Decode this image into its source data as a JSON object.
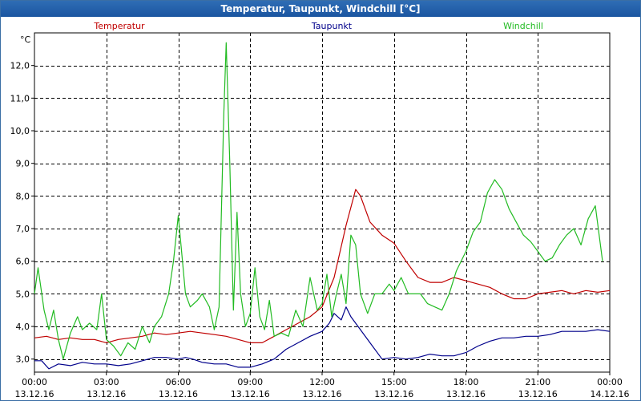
{
  "window": {
    "title": "Temperatur, Taupunkt, Windchill [°C]"
  },
  "chart_data": {
    "type": "line",
    "title": "Temperatur, Taupunkt, Windchill [°C]",
    "ylabel": "°C",
    "xlabel": "",
    "ylim": [
      2.6,
      13.0
    ],
    "xlim": [
      0,
      24
    ],
    "grid": true,
    "legend": "top",
    "yticks": [
      3.0,
      4.0,
      5.0,
      6.0,
      7.0,
      8.0,
      9.0,
      10.0,
      11.0,
      12.0
    ],
    "ytick_labels": [
      "3,0",
      "4,0",
      "5,0",
      "6,0",
      "7,0",
      "8,0",
      "9,0",
      "10,0",
      "11,0",
      "12,0"
    ],
    "xticks": [
      0,
      3,
      6,
      9,
      12,
      15,
      18,
      21,
      24
    ],
    "xtick_labels": [
      [
        "00:00",
        "13.12.16"
      ],
      [
        "03:00",
        "13.12.16"
      ],
      [
        "06:00",
        "13.12.16"
      ],
      [
        "09:00",
        "13.12.16"
      ],
      [
        "12:00",
        "13.12.16"
      ],
      [
        "15:00",
        "13.12.16"
      ],
      [
        "18:00",
        "13.12.16"
      ],
      [
        "21:00",
        "13.12.16"
      ],
      [
        "00:00",
        "14.12.16"
      ]
    ],
    "series": [
      {
        "name": "Temperatur",
        "color": "#c00000",
        "points": [
          [
            0,
            3.65
          ],
          [
            0.5,
            3.7
          ],
          [
            1,
            3.6
          ],
          [
            1.5,
            3.65
          ],
          [
            2,
            3.6
          ],
          [
            2.5,
            3.6
          ],
          [
            3,
            3.5
          ],
          [
            3.5,
            3.6
          ],
          [
            4,
            3.65
          ],
          [
            4.5,
            3.7
          ],
          [
            5,
            3.8
          ],
          [
            5.5,
            3.75
          ],
          [
            6,
            3.8
          ],
          [
            6.5,
            3.85
          ],
          [
            7,
            3.8
          ],
          [
            7.5,
            3.75
          ],
          [
            8,
            3.7
          ],
          [
            8.5,
            3.6
          ],
          [
            9,
            3.5
          ],
          [
            9.5,
            3.5
          ],
          [
            10,
            3.7
          ],
          [
            10.5,
            3.9
          ],
          [
            11,
            4.1
          ],
          [
            11.5,
            4.3
          ],
          [
            12,
            4.6
          ],
          [
            12.5,
            5.5
          ],
          [
            13,
            7.1
          ],
          [
            13.4,
            8.2
          ],
          [
            13.6,
            8.0
          ],
          [
            14,
            7.2
          ],
          [
            14.5,
            6.8
          ],
          [
            15,
            6.55
          ],
          [
            15.5,
            6.0
          ],
          [
            16,
            5.5
          ],
          [
            16.5,
            5.35
          ],
          [
            17,
            5.35
          ],
          [
            17.5,
            5.5
          ],
          [
            18,
            5.4
          ],
          [
            18.5,
            5.3
          ],
          [
            19,
            5.2
          ],
          [
            19.5,
            5.0
          ],
          [
            20,
            4.85
          ],
          [
            20.5,
            4.85
          ],
          [
            21,
            5.0
          ],
          [
            21.5,
            5.05
          ],
          [
            22,
            5.1
          ],
          [
            22.5,
            5.0
          ],
          [
            23,
            5.1
          ],
          [
            23.5,
            5.05
          ],
          [
            24,
            5.1
          ]
        ]
      },
      {
        "name": "Taupunkt",
        "color": "#00008b",
        "points": [
          [
            0,
            2.95
          ],
          [
            0.3,
            2.95
          ],
          [
            0.6,
            2.7
          ],
          [
            1,
            2.85
          ],
          [
            1.5,
            2.8
          ],
          [
            2,
            2.9
          ],
          [
            2.5,
            2.85
          ],
          [
            3,
            2.85
          ],
          [
            3.5,
            2.8
          ],
          [
            4,
            2.85
          ],
          [
            4.5,
            2.95
          ],
          [
            5,
            3.05
          ],
          [
            5.5,
            3.05
          ],
          [
            6,
            3.0
          ],
          [
            6.3,
            3.05
          ],
          [
            6.6,
            3.0
          ],
          [
            7,
            2.9
          ],
          [
            7.5,
            2.85
          ],
          [
            8,
            2.85
          ],
          [
            8.5,
            2.75
          ],
          [
            9,
            2.75
          ],
          [
            9.5,
            2.85
          ],
          [
            10,
            3.0
          ],
          [
            10.5,
            3.3
          ],
          [
            11,
            3.5
          ],
          [
            11.5,
            3.7
          ],
          [
            12,
            3.85
          ],
          [
            12.3,
            4.1
          ],
          [
            12.5,
            4.4
          ],
          [
            12.8,
            4.2
          ],
          [
            13,
            4.6
          ],
          [
            13.2,
            4.3
          ],
          [
            13.5,
            4.0
          ],
          [
            14,
            3.5
          ],
          [
            14.5,
            3.0
          ],
          [
            15,
            3.05
          ],
          [
            15.5,
            3.0
          ],
          [
            16,
            3.05
          ],
          [
            16.5,
            3.15
          ],
          [
            17,
            3.1
          ],
          [
            17.5,
            3.1
          ],
          [
            18,
            3.2
          ],
          [
            18.5,
            3.4
          ],
          [
            19,
            3.55
          ],
          [
            19.5,
            3.65
          ],
          [
            20,
            3.65
          ],
          [
            20.5,
            3.7
          ],
          [
            21,
            3.7
          ],
          [
            21.5,
            3.75
          ],
          [
            22,
            3.85
          ],
          [
            22.5,
            3.85
          ],
          [
            23,
            3.85
          ],
          [
            23.5,
            3.9
          ],
          [
            24,
            3.85
          ]
        ]
      },
      {
        "name": "Windchill",
        "color": "#22bb22",
        "points": [
          [
            0,
            5.0
          ],
          [
            0.15,
            5.8
          ],
          [
            0.4,
            4.5
          ],
          [
            0.6,
            3.9
          ],
          [
            0.8,
            4.5
          ],
          [
            1.0,
            3.6
          ],
          [
            1.2,
            3.0
          ],
          [
            1.5,
            3.8
          ],
          [
            1.8,
            4.3
          ],
          [
            2.0,
            3.9
          ],
          [
            2.3,
            4.1
          ],
          [
            2.6,
            3.9
          ],
          [
            2.8,
            5.0
          ],
          [
            3.0,
            3.6
          ],
          [
            3.3,
            3.4
          ],
          [
            3.6,
            3.1
          ],
          [
            3.9,
            3.5
          ],
          [
            4.2,
            3.3
          ],
          [
            4.5,
            4.0
          ],
          [
            4.8,
            3.5
          ],
          [
            5.0,
            4.0
          ],
          [
            5.3,
            4.3
          ],
          [
            5.6,
            5.0
          ],
          [
            5.8,
            6.0
          ],
          [
            6.0,
            7.4
          ],
          [
            6.3,
            5.0
          ],
          [
            6.5,
            4.6
          ],
          [
            6.8,
            4.8
          ],
          [
            7.0,
            5.0
          ],
          [
            7.3,
            4.6
          ],
          [
            7.5,
            3.9
          ],
          [
            7.7,
            4.6
          ],
          [
            7.9,
            10.5
          ],
          [
            8.0,
            12.7
          ],
          [
            8.15,
            9.0
          ],
          [
            8.3,
            4.5
          ],
          [
            8.45,
            7.5
          ],
          [
            8.6,
            5.0
          ],
          [
            8.8,
            4.0
          ],
          [
            9.0,
            4.4
          ],
          [
            9.2,
            5.8
          ],
          [
            9.4,
            4.3
          ],
          [
            9.6,
            3.9
          ],
          [
            9.8,
            4.8
          ],
          [
            10.0,
            3.7
          ],
          [
            10.3,
            3.8
          ],
          [
            10.6,
            3.7
          ],
          [
            10.9,
            4.5
          ],
          [
            11.2,
            4.0
          ],
          [
            11.5,
            5.5
          ],
          [
            11.8,
            4.5
          ],
          [
            12.0,
            4.7
          ],
          [
            12.2,
            5.6
          ],
          [
            12.4,
            4.3
          ],
          [
            12.6,
            5.0
          ],
          [
            12.8,
            5.6
          ],
          [
            13.0,
            4.7
          ],
          [
            13.2,
            6.8
          ],
          [
            13.4,
            6.5
          ],
          [
            13.6,
            5.0
          ],
          [
            13.9,
            4.4
          ],
          [
            14.2,
            5.0
          ],
          [
            14.5,
            5.0
          ],
          [
            14.8,
            5.3
          ],
          [
            15.0,
            5.1
          ],
          [
            15.3,
            5.5
          ],
          [
            15.6,
            5.0
          ],
          [
            15.8,
            5.0
          ],
          [
            16.1,
            5.0
          ],
          [
            16.4,
            4.7
          ],
          [
            16.7,
            4.6
          ],
          [
            17.0,
            4.5
          ],
          [
            17.3,
            5.0
          ],
          [
            17.6,
            5.7
          ],
          [
            18.0,
            6.3
          ],
          [
            18.3,
            6.9
          ],
          [
            18.6,
            7.2
          ],
          [
            18.9,
            8.1
          ],
          [
            19.2,
            8.5
          ],
          [
            19.5,
            8.2
          ],
          [
            19.8,
            7.6
          ],
          [
            20.1,
            7.2
          ],
          [
            20.4,
            6.8
          ],
          [
            20.7,
            6.6
          ],
          [
            21.0,
            6.3
          ],
          [
            21.3,
            6.0
          ],
          [
            21.6,
            6.1
          ],
          [
            21.9,
            6.5
          ],
          [
            22.2,
            6.8
          ],
          [
            22.5,
            7.0
          ],
          [
            22.8,
            6.5
          ],
          [
            23.1,
            7.3
          ],
          [
            23.4,
            7.7
          ],
          [
            23.7,
            6.0
          ]
        ]
      }
    ]
  }
}
